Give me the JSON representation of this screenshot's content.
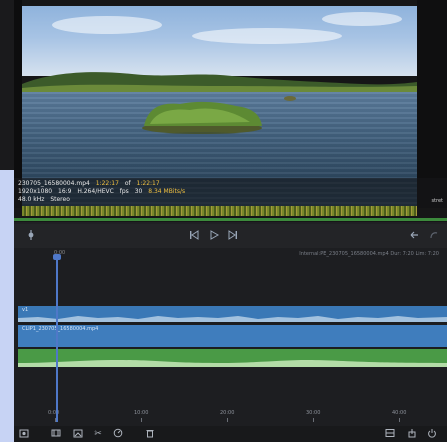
{
  "video": {
    "filename": "230705_16580004.mp4",
    "position": "1:22:17",
    "of_label": "of",
    "duration": "1:22:17",
    "resolution": "1920x1080",
    "aspect": "16:9",
    "codec": "H.264/HEVC",
    "fps": "30",
    "fps_label": "fps",
    "bitrate": "8.34 MBits/s",
    "audio_rate": "48.0 kHz",
    "audio_channels": "Stereo",
    "effect_tag": "stret"
  },
  "playback": {
    "progress_percent": 100
  },
  "timeline": {
    "project_label": "Internal:PE_230705_16580004.mp4 Dur: 7:20 Lim: 7:20",
    "clip_label_top": "v1",
    "clip_label_main": "CLIP1_230705_16580004.mp4",
    "start_marker": "0:00",
    "ticks": [
      "0:00",
      "10:00",
      "20:00",
      "30:00",
      "40:00"
    ]
  },
  "icons": {
    "filter": "filter-icon",
    "skip_back": "skip-back-icon",
    "play": "play-icon",
    "skip_forward": "skip-forward-icon",
    "undo": "undo-icon",
    "redo": "redo-icon"
  },
  "colors": {
    "video_track": "#3a78b6",
    "audio_track": "#4a9a46",
    "playhead": "#4f78c8",
    "progress": "#3c8a3c"
  }
}
